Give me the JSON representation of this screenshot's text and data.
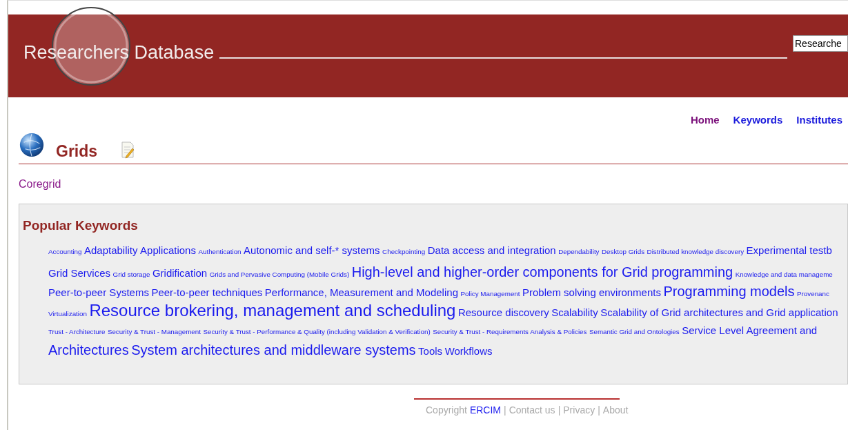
{
  "header": {
    "title": "Researchers Database",
    "search": {
      "value": "Researche"
    }
  },
  "nav": [
    {
      "label": "Home",
      "visited": true
    },
    {
      "label": "Keywords",
      "visited": false
    },
    {
      "label": "Institutes",
      "visited": false
    }
  ],
  "page": {
    "title": "Grids",
    "link": "Coregrid"
  },
  "popular_keywords": {
    "title": "Popular Keywords",
    "lines": [
      [
        {
          "text": "Accounting",
          "kind": "xs"
        },
        {
          "text": "Adaptability",
          "kind": "m"
        },
        {
          "text": "Applications",
          "kind": "m"
        },
        {
          "text": "Authentication",
          "kind": "xs"
        },
        {
          "text": "Autonomic and self-* systems",
          "kind": "m"
        },
        {
          "text": "Checkpointing",
          "kind": "xs"
        },
        {
          "text": "Data access and integration",
          "kind": "m"
        },
        {
          "text": "Dependability",
          "kind": "xs"
        },
        {
          "text": "Desktop Grids",
          "kind": "xs"
        },
        {
          "text": "Distributed knowledge discovery",
          "kind": "xs"
        },
        {
          "text": "Experimental testb",
          "kind": "m"
        }
      ],
      [
        {
          "text": "Grid Services",
          "kind": "m"
        },
        {
          "text": "Grid storage",
          "kind": "xs"
        },
        {
          "text": "Gridification",
          "kind": "m"
        },
        {
          "text": "Grids and Pervasive Computing (Mobile Grids)",
          "kind": "xs"
        },
        {
          "text": "High-level and higher-order components for Grid programming",
          "kind": "l"
        },
        {
          "text": "Knowledge and data manageme",
          "kind": "xs"
        }
      ],
      [
        {
          "text": "Peer-to-peer Systems",
          "kind": "m"
        },
        {
          "text": "Peer-to-peer techniques",
          "kind": "m"
        },
        {
          "text": "Performance, Measurement and Modeling",
          "kind": "m"
        },
        {
          "text": "Policy Management",
          "kind": "xs"
        },
        {
          "text": "Problem solving environments",
          "kind": "m"
        },
        {
          "text": "Programming models",
          "kind": "l"
        },
        {
          "text": "Provenanc",
          "kind": "xs"
        }
      ],
      [
        {
          "text": "Virtualization",
          "kind": "xs"
        },
        {
          "text": "Resource brokering, management and scheduling",
          "kind": "xl"
        },
        {
          "text": "Resource discovery",
          "kind": "m"
        },
        {
          "text": "Scalability",
          "kind": "m"
        },
        {
          "text": "Scalability of Grid architectures and Grid application",
          "kind": "m"
        }
      ],
      [
        {
          "text": "Trust - Architecture",
          "kind": "xs"
        },
        {
          "text": "Security & Trust - Management",
          "kind": "xs"
        },
        {
          "text": "Security & Trust - Performance & Quality (including Validation & Verification)",
          "kind": "xs"
        },
        {
          "text": "Security & Trust - Requirements Analysis & Policies",
          "kind": "xs"
        },
        {
          "text": "Semantic Grid and Ontologies",
          "kind": "xs"
        },
        {
          "text": "Service Level Agreement and",
          "kind": "m"
        }
      ],
      [
        {
          "text": "Architectures",
          "kind": "l"
        },
        {
          "text": "System architectures and middleware systems",
          "kind": "l"
        },
        {
          "text": "Tools",
          "kind": "m"
        },
        {
          "text": "Workflows",
          "kind": "m"
        }
      ]
    ]
  },
  "footer": {
    "copyright": "Copyright",
    "link": "ERCIM",
    "separator": "|",
    "items": [
      "Contact us",
      "Privacy",
      "About"
    ]
  }
}
